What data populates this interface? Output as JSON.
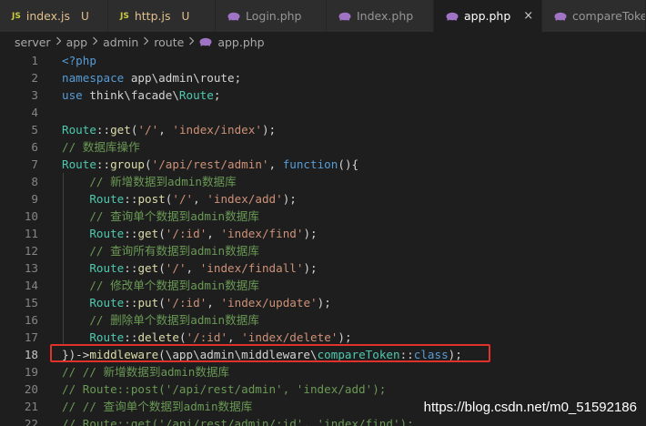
{
  "tabs": [
    {
      "label": "index.js",
      "type": "js",
      "status": "U",
      "active": false
    },
    {
      "label": "http.js",
      "type": "js",
      "status": "U",
      "active": false
    },
    {
      "label": "Login.php",
      "type": "php",
      "status": "",
      "active": false
    },
    {
      "label": "Index.php",
      "type": "php",
      "status": "",
      "active": false
    },
    {
      "label": "app.php",
      "type": "php",
      "status": "",
      "active": true
    },
    {
      "label": "compareToken",
      "type": "php",
      "status": "",
      "active": false
    }
  ],
  "close_glyph": "×",
  "js_badge": "JS",
  "breadcrumb": [
    "server",
    "app",
    "admin",
    "route",
    "app.php"
  ],
  "lines": [
    [
      [
        "kw",
        "<?php"
      ]
    ],
    [
      [
        "kw",
        "namespace "
      ],
      [
        "ns",
        "app\\admin\\route"
      ],
      [
        "pl",
        ";"
      ]
    ],
    [
      [
        "kw",
        "use "
      ],
      [
        "ns",
        "think\\facade\\"
      ],
      [
        "cls",
        "Route"
      ],
      [
        "pl",
        ";"
      ]
    ],
    [],
    [
      [
        "cls",
        "Route"
      ],
      [
        "pl",
        "::"
      ],
      [
        "fn",
        "get"
      ],
      [
        "pl",
        "("
      ],
      [
        "str",
        "'/'"
      ],
      [
        "pl",
        ", "
      ],
      [
        "str",
        "'index/index'"
      ],
      [
        "pl",
        ");"
      ]
    ],
    [
      [
        "cm",
        "// 数据库操作"
      ]
    ],
    [
      [
        "cls",
        "Route"
      ],
      [
        "pl",
        "::"
      ],
      [
        "fn",
        "group"
      ],
      [
        "pl",
        "("
      ],
      [
        "str",
        "'/api/rest/admin'"
      ],
      [
        "pl",
        ", "
      ],
      [
        "kw",
        "function"
      ],
      [
        "pl",
        "(){"
      ]
    ],
    [
      [
        "cm",
        "    // 新增数据到admin数据库"
      ]
    ],
    [
      [
        "pl",
        "    "
      ],
      [
        "cls",
        "Route"
      ],
      [
        "pl",
        "::"
      ],
      [
        "fn",
        "post"
      ],
      [
        "pl",
        "("
      ],
      [
        "str",
        "'/'"
      ],
      [
        "pl",
        ", "
      ],
      [
        "str",
        "'index/add'"
      ],
      [
        "pl",
        ");"
      ]
    ],
    [
      [
        "cm",
        "    // 查询单个数据到admin数据库"
      ]
    ],
    [
      [
        "pl",
        "    "
      ],
      [
        "cls",
        "Route"
      ],
      [
        "pl",
        "::"
      ],
      [
        "fn",
        "get"
      ],
      [
        "pl",
        "("
      ],
      [
        "str",
        "'/:id'"
      ],
      [
        "pl",
        ", "
      ],
      [
        "str",
        "'index/find'"
      ],
      [
        "pl",
        ");"
      ]
    ],
    [
      [
        "cm",
        "    // 查询所有数据到admin数据库"
      ]
    ],
    [
      [
        "pl",
        "    "
      ],
      [
        "cls",
        "Route"
      ],
      [
        "pl",
        "::"
      ],
      [
        "fn",
        "get"
      ],
      [
        "pl",
        "("
      ],
      [
        "str",
        "'/'"
      ],
      [
        "pl",
        ", "
      ],
      [
        "str",
        "'index/findall'"
      ],
      [
        "pl",
        ");"
      ]
    ],
    [
      [
        "cm",
        "    // 修改单个数据到admin数据库"
      ]
    ],
    [
      [
        "pl",
        "    "
      ],
      [
        "cls",
        "Route"
      ],
      [
        "pl",
        "::"
      ],
      [
        "fn",
        "put"
      ],
      [
        "pl",
        "("
      ],
      [
        "str",
        "'/:id'"
      ],
      [
        "pl",
        ", "
      ],
      [
        "str",
        "'index/update'"
      ],
      [
        "pl",
        ");"
      ]
    ],
    [
      [
        "cm",
        "    // 删除单个数据到admin数据库"
      ]
    ],
    [
      [
        "pl",
        "    "
      ],
      [
        "cls",
        "Route"
      ],
      [
        "pl",
        "::"
      ],
      [
        "fn",
        "delete"
      ],
      [
        "pl",
        "("
      ],
      [
        "str",
        "'/:id'"
      ],
      [
        "pl",
        ", "
      ],
      [
        "str",
        "'index/delete'"
      ],
      [
        "pl",
        ");"
      ]
    ],
    [
      [
        "pl",
        "})->"
      ],
      [
        "fn",
        "middleware"
      ],
      [
        "pl",
        "("
      ],
      [
        "ns",
        "\\app\\admin\\middleware\\"
      ],
      [
        "cls",
        "compareToken"
      ],
      [
        "pl",
        "::"
      ],
      [
        "kw",
        "class"
      ],
      [
        "pl",
        ");"
      ]
    ],
    [
      [
        "cm",
        "// // 新增数据到admin数据库"
      ]
    ],
    [
      [
        "cm",
        "// Route::post('/api/rest/admin', 'index/add');"
      ]
    ],
    [
      [
        "cm",
        "// // 查询单个数据到admin数据库"
      ]
    ],
    [
      [
        "cm",
        "// Route::get('/api/rest/admin/:id', 'index/find');"
      ]
    ]
  ],
  "current_line": 18,
  "watermark": "https://blog.csdn.net/m0_51592186",
  "colors": {
    "background": "#1e1e1e",
    "tab_inactive": "#2d2d2d",
    "keyword": "#569cd6",
    "class": "#4ec9b0",
    "function": "#dcdcaa",
    "string": "#ce9178",
    "comment": "#6a9955",
    "highlight_box": "#e0312b",
    "php_icon": "#a074c4",
    "js_icon": "#cbcb41"
  }
}
